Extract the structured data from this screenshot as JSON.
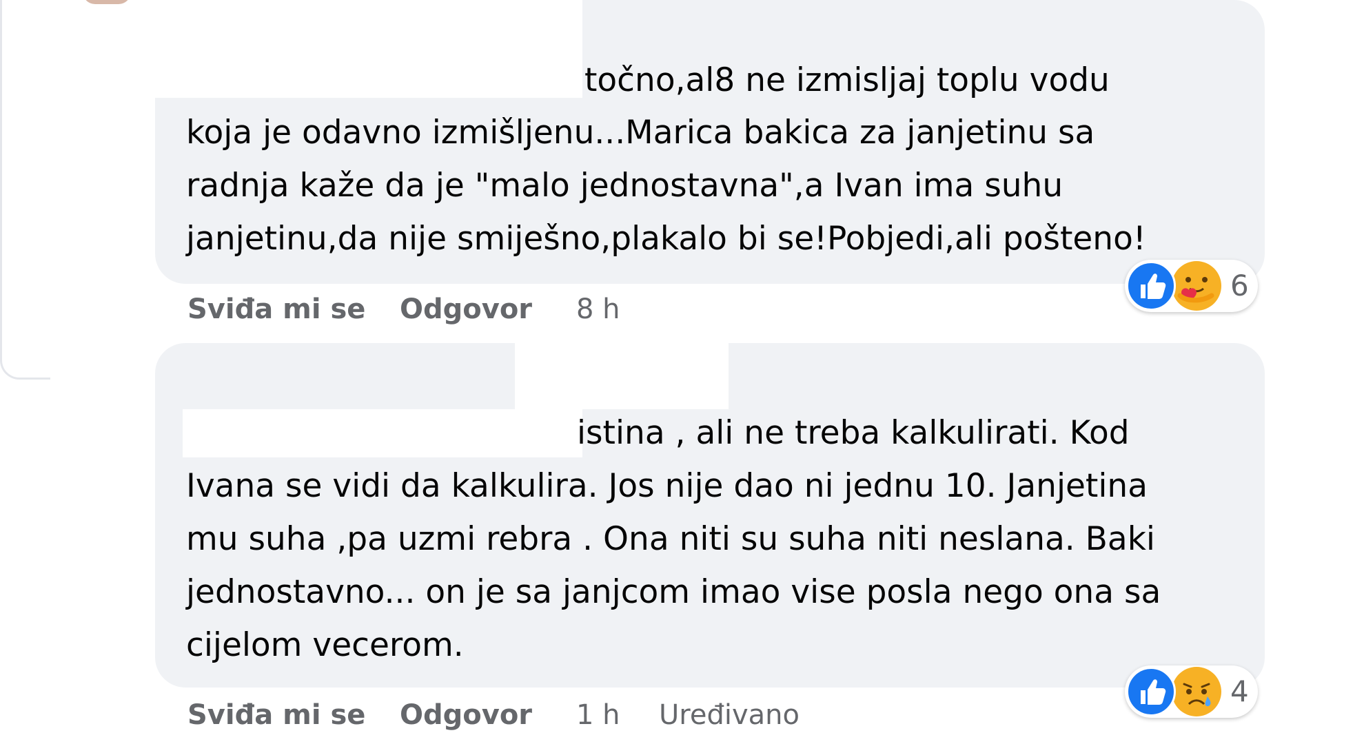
{
  "colors": {
    "bubble_bg": "#f0f2f5",
    "text": "#050505",
    "meta_text": "#65676b",
    "like_blue": "#1877f2",
    "emoji_yellow": "#f7b125"
  },
  "comments": [
    {
      "lines": [
        "točno,al8 ne izmisljaj toplu vodu",
        "koja je odavno izmišljenu...Marica bakica za janjetinu sa",
        "radnja kaže da je \"malo jednostavna\",a Ivan ima suhu",
        "janjetinu,da nije smiješno,plakalo bi se!Pobjedi,ali pošteno!"
      ],
      "reactions": {
        "icons": [
          "like-icon",
          "care-icon"
        ],
        "count": "6"
      },
      "actions": {
        "like_label": "Sviđa mi se",
        "reply_label": "Odgovor",
        "time": "8 h"
      }
    },
    {
      "lines": [
        "istina , ali ne treba kalkulirati. Kod",
        "Ivana se vidi da kalkulira. Jos nije dao ni jednu 10. Janjetina",
        "mu suha ,pa uzmi rebra . Ona niti su suha niti neslana. Baki",
        "jednostavno... on je sa janjcom imao vise posla nego ona sa",
        "cijelom vecerom."
      ],
      "reactions": {
        "icons": [
          "like-icon",
          "sad-icon"
        ],
        "count": "4"
      },
      "actions": {
        "like_label": "Sviđa mi se",
        "reply_label": "Odgovor",
        "time": "1 h",
        "edited": "Uređivano"
      }
    }
  ]
}
